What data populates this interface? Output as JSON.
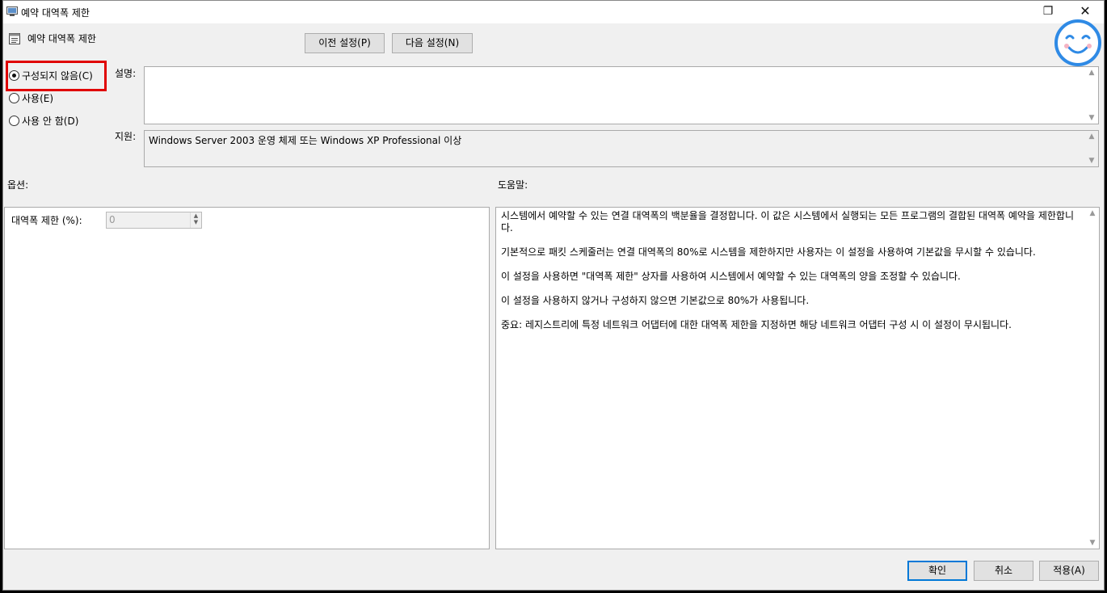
{
  "window": {
    "title": "예약 대역폭 제한",
    "restore_glyph": "❐",
    "close_glyph": "✕"
  },
  "header": {
    "title": "예약 대역폭 제한"
  },
  "nav": {
    "prev_label": "이전 설정(P)",
    "next_label": "다음 설정(N)"
  },
  "state": {
    "options": [
      {
        "label": "구성되지 않음(C)",
        "checked": true
      },
      {
        "label": "사용(E)",
        "checked": false
      },
      {
        "label": "사용 안 함(D)",
        "checked": false
      }
    ]
  },
  "comment": {
    "label": "설명:",
    "value": ""
  },
  "support": {
    "label": "지원:",
    "value": "Windows Server 2003 운영 체제 또는 Windows XP Professional 이상"
  },
  "options_panel": {
    "label": "옵션:",
    "field_label": "대역폭 제한 (%):",
    "field_value": "0"
  },
  "help": {
    "label": "도움말:",
    "paragraphs": [
      "시스템에서 예약할 수 있는 연결 대역폭의 백분율을 결정합니다. 이 값은 시스템에서 실행되는 모든 프로그램의 결합된 대역폭 예약을 제한합니다.",
      "기본적으로 패킷 스케줄러는 연결 대역폭의 80%로 시스템을 제한하지만 사용자는 이 설정을 사용하여 기본값을 무시할 수 있습니다.",
      "이 설정을 사용하면 \"대역폭 제한\" 상자를 사용하여 시스템에서 예약할 수 있는 대역폭의 양을 조정할 수 있습니다.",
      "이 설정을 사용하지 않거나 구성하지 않으면 기본값으로 80%가 사용됩니다.",
      "중요: 레지스트리에 특정 네트워크 어댑터에 대한 대역폭 제한을 지정하면 해당 네트워크 어댑터 구성 시 이 설정이 무시됩니다."
    ]
  },
  "footer": {
    "ok_label": "확인",
    "cancel_label": "취소",
    "apply_label": "적용(A)"
  },
  "colors": {
    "highlight": "#e00000",
    "smiley": "#2f8ae5"
  }
}
